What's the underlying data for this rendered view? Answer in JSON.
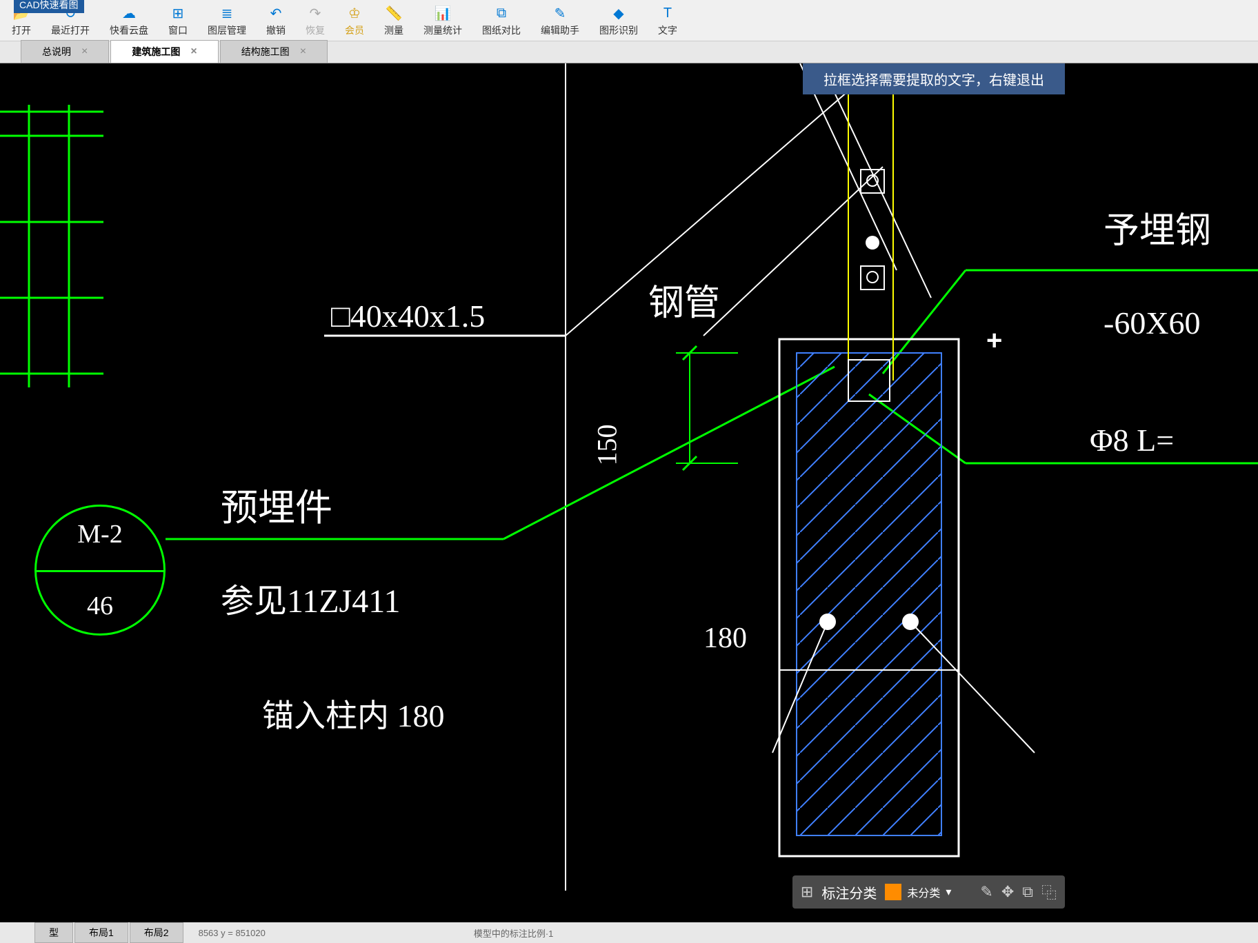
{
  "app_title": "CAD快速看图",
  "toolbar": {
    "open": "打开",
    "recent": "最近打开",
    "cloud": "快看云盘",
    "window": "窗口",
    "layer": "图层管理",
    "undo": "撤销",
    "redo": "恢复",
    "vip": "会员",
    "measure": "测量",
    "stat": "测量统计",
    "compare": "图纸对比",
    "assist": "编辑助手",
    "recognize": "图形识别",
    "text": "文字"
  },
  "tabs": {
    "t1": "总说明",
    "t2": "建筑施工图",
    "t3": "结构施工图"
  },
  "hint": "拉框选择需要提取的文字，右键退出",
  "drawing": {
    "spec1": "□40x40x1.5",
    "pipe": "钢管",
    "embedded_right": "予埋钢",
    "dim1": "150",
    "dim2": "180",
    "plate": "-60X60",
    "rebar": "Φ8  L=",
    "embedded_part": "预埋件",
    "ref": "参见11ZJ411",
    "anchor": "锚入柱内  180",
    "mark_top": "M-2",
    "mark_bottom": "46"
  },
  "annotation": {
    "classify": "标注分类",
    "unclassified": "未分类"
  },
  "layout": {
    "l1": "布局1",
    "l2": "布局2",
    "model": "型"
  },
  "status": {
    "coords": "8563 y = 851020",
    "scale": "模型中的标注比例·1"
  }
}
